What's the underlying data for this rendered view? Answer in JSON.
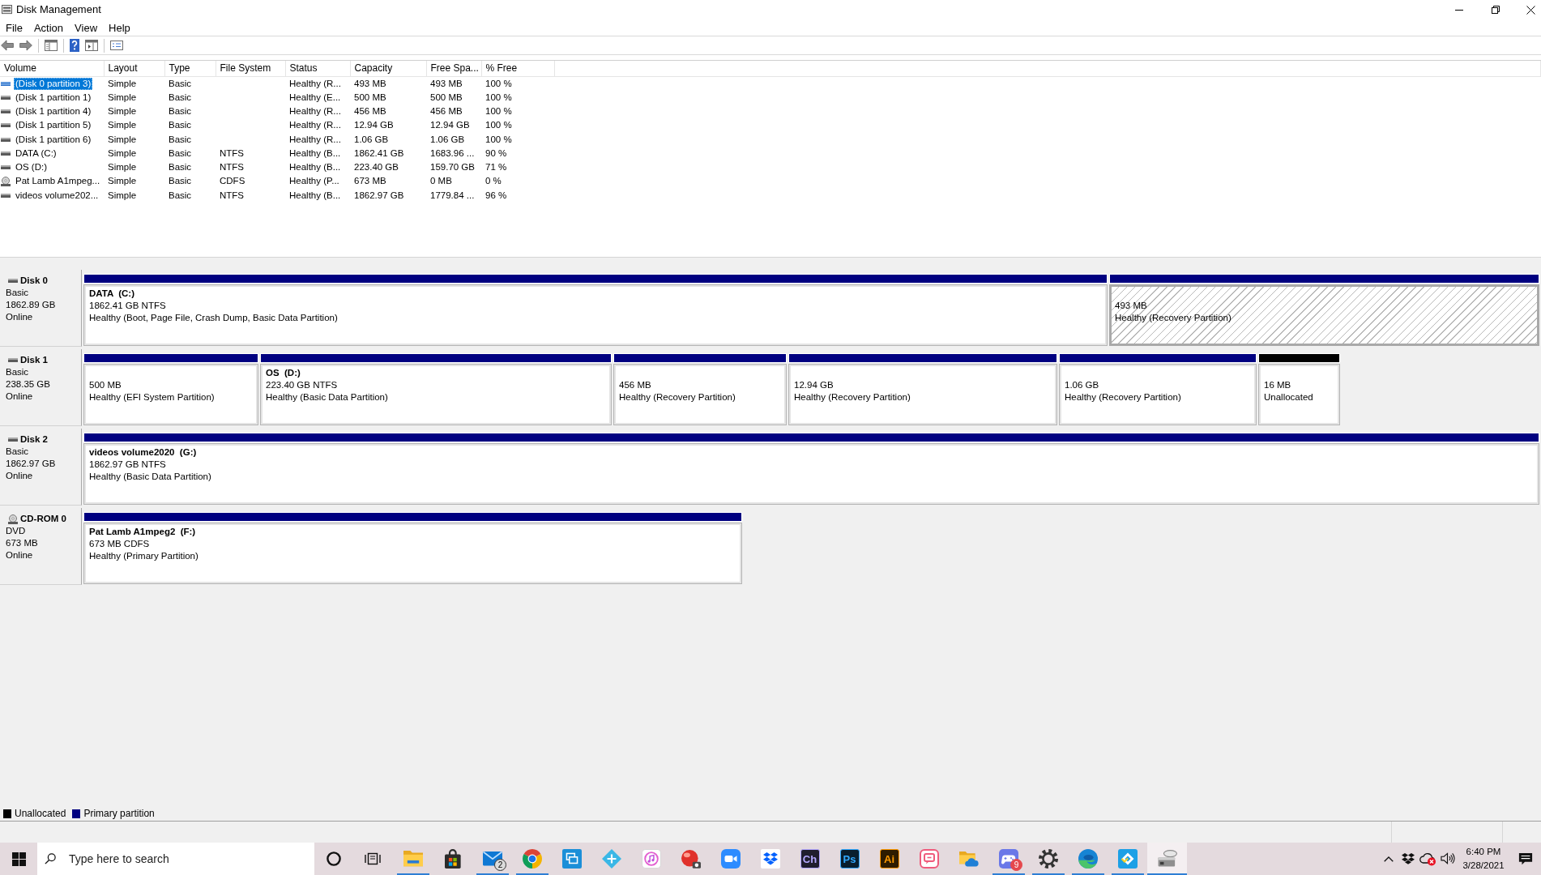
{
  "window": {
    "title": "Disk Management"
  },
  "menu": [
    "File",
    "Action",
    "View",
    "Help"
  ],
  "volume_table": {
    "columns": [
      "Volume",
      "Layout",
      "Type",
      "File System",
      "Status",
      "Capacity",
      "Free Spa...",
      "% Free"
    ],
    "rows": [
      {
        "kind": "disk",
        "selected": true,
        "cells": [
          "(Disk 0 partition 3)",
          "Simple",
          "Basic",
          null,
          "Healthy (R...",
          "493 MB",
          "493 MB",
          "100 %"
        ]
      },
      {
        "kind": "disk",
        "selected": false,
        "cells": [
          "(Disk 1 partition 1)",
          "Simple",
          "Basic",
          null,
          "Healthy (E...",
          "500 MB",
          "500 MB",
          "100 %"
        ]
      },
      {
        "kind": "disk",
        "selected": false,
        "cells": [
          "(Disk 1 partition 4)",
          "Simple",
          "Basic",
          null,
          "Healthy (R...",
          "456 MB",
          "456 MB",
          "100 %"
        ]
      },
      {
        "kind": "disk",
        "selected": false,
        "cells": [
          "(Disk 1 partition 5)",
          "Simple",
          "Basic",
          null,
          "Healthy (R...",
          "12.94 GB",
          "12.94 GB",
          "100 %"
        ]
      },
      {
        "kind": "disk",
        "selected": false,
        "cells": [
          "(Disk 1 partition 6)",
          "Simple",
          "Basic",
          null,
          "Healthy (R...",
          "1.06 GB",
          "1.06 GB",
          "100 %"
        ]
      },
      {
        "kind": "disk",
        "selected": false,
        "cells": [
          "DATA (C:)",
          "Simple",
          "Basic",
          "NTFS",
          "Healthy (B...",
          "1862.41 GB",
          "1683.96 ...",
          "90 %"
        ]
      },
      {
        "kind": "disk",
        "selected": false,
        "cells": [
          "OS (D:)",
          "Simple",
          "Basic",
          "NTFS",
          "Healthy (B...",
          "223.40 GB",
          "159.70 GB",
          "71 %"
        ]
      },
      {
        "kind": "cdrom",
        "selected": false,
        "cells": [
          "Pat Lamb A1mpeg...",
          "Simple",
          "Basic",
          "CDFS",
          "Healthy (P...",
          "673 MB",
          "0 MB",
          "0 %"
        ]
      },
      {
        "kind": "disk",
        "selected": false,
        "cells": [
          "videos volume202...",
          "Simple",
          "Basic",
          "NTFS",
          "Healthy (B...",
          "1862.97 GB",
          "1779.84 ...",
          "96 %"
        ]
      }
    ]
  },
  "disks": [
    {
      "kind": "disk",
      "name": "Disk 0",
      "type": "Basic",
      "size": "1862.89 GB",
      "status": "Online",
      "partitions": [
        {
          "kind": "primary",
          "selected": false,
          "title": "DATA  (C:)",
          "size": "1862.41 GB NTFS",
          "status": "Healthy (Boot, Page File, Crash Dump, Basic Data Partition)"
        },
        {
          "kind": "primary",
          "selected": true,
          "size": "493 MB",
          "status": "Healthy (Recovery Partition)"
        }
      ]
    },
    {
      "kind": "disk",
      "name": "Disk 1",
      "type": "Basic",
      "size": "238.35 GB",
      "status": "Online",
      "partitions": [
        {
          "kind": "primary",
          "selected": false,
          "size": "500 MB",
          "status": "Healthy (EFI System Partition)"
        },
        {
          "kind": "primary",
          "selected": false,
          "title": "OS  (D:)",
          "size": "223.40 GB NTFS",
          "status": "Healthy (Basic Data Partition)"
        },
        {
          "kind": "primary",
          "selected": false,
          "size": "456 MB",
          "status": "Healthy (Recovery Partition)"
        },
        {
          "kind": "primary",
          "selected": false,
          "size": "12.94 GB",
          "status": "Healthy (Recovery Partition)"
        },
        {
          "kind": "primary",
          "selected": false,
          "size": "1.06 GB",
          "status": "Healthy (Recovery Partition)"
        },
        {
          "kind": "unallocated",
          "selected": false,
          "size": "16 MB",
          "status": "Unallocated"
        }
      ]
    },
    {
      "kind": "disk",
      "name": "Disk 2",
      "type": "Basic",
      "size": "1862.97 GB",
      "status": "Online",
      "partitions": [
        {
          "kind": "primary",
          "selected": false,
          "title": "videos volume2020  (G:)",
          "size": "1862.97 GB NTFS",
          "status": "Healthy (Basic Data Partition)"
        }
      ]
    },
    {
      "kind": "cdrom",
      "name": "CD-ROM 0",
      "type": "DVD",
      "size": "673 MB",
      "status": "Online",
      "partitions": [
        {
          "kind": "primary",
          "selected": false,
          "title": "Pat Lamb A1mpeg2  (F:)",
          "size": "673 MB CDFS",
          "status": "Healthy (Primary Partition)"
        }
      ]
    }
  ],
  "legend": [
    {
      "label": "Unallocated",
      "color": "#000000"
    },
    {
      "label": "Primary partition",
      "color": "#000080"
    }
  ],
  "taskbar": {
    "search": {
      "placeholder": "Type here to search"
    },
    "apps": [
      {
        "kind": "folder",
        "running": true,
        "selected": false
      },
      {
        "kind": "bag",
        "running": false,
        "selected": false
      },
      {
        "kind": "envelope",
        "running": true,
        "selected": false,
        "badge": "2"
      },
      {
        "kind": "tricolor",
        "running": true,
        "selected": false
      },
      {
        "kind": "tile",
        "running": false,
        "selected": false
      },
      {
        "kind": "diamond",
        "running": false,
        "selected": false
      },
      {
        "kind": "note",
        "running": false,
        "selected": false
      },
      {
        "kind": "ball",
        "running": false,
        "selected": false
      },
      {
        "kind": "camera",
        "running": false,
        "selected": false
      },
      {
        "kind": "boxes",
        "running": false,
        "selected": false
      },
      {
        "kind": "letters",
        "running": false,
        "selected": false,
        "label": "Ch",
        "color": "#b4a8ff"
      },
      {
        "kind": "letters",
        "running": false,
        "selected": false,
        "label": "Ps",
        "color": "#31a8ff"
      },
      {
        "kind": "letters",
        "running": false,
        "selected": false,
        "label": "Ai",
        "color": "#ff9a00"
      },
      {
        "kind": "chat",
        "running": false,
        "selected": false
      },
      {
        "kind": "cloud",
        "running": false,
        "selected": false
      },
      {
        "kind": "controller",
        "running": true,
        "selected": false,
        "badge": "9"
      },
      {
        "kind": "gear",
        "running": true,
        "selected": false
      },
      {
        "kind": "swirl",
        "running": true,
        "selected": false
      },
      {
        "kind": "rhombus",
        "running": true,
        "selected": false
      },
      {
        "kind": "drive",
        "running": true,
        "selected": true
      }
    ],
    "clock": {
      "time": "6:40 PM",
      "date": "3/28/2021"
    }
  }
}
